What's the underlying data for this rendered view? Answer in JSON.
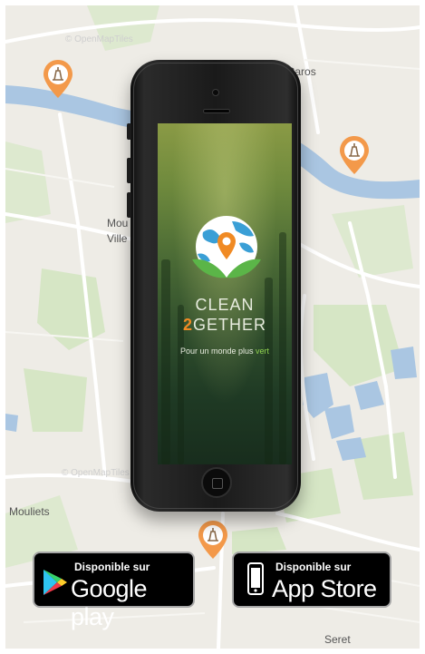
{
  "map": {
    "places": {
      "le_caros": "Le Caros",
      "mou": "Mou",
      "ville": "Ville",
      "mouliets": "Mouliets",
      "seret": "Seret"
    },
    "watermark": "© OpenMapTiles",
    "pin_icon": "litter-location-pin-icon",
    "colors": {
      "land": "#eeece6",
      "water": "#aac6e2",
      "park": "#d6e6c5",
      "road": "#ffffff",
      "pin": "#f3994a"
    }
  },
  "phone": {
    "app": {
      "title_line1": "CLEAN",
      "title_number": "2",
      "title_rest": "GETHER",
      "tagline_main": "Pour un monde plus ",
      "tagline_accent": "vert"
    }
  },
  "badges": {
    "google": {
      "small": "Disponible sur",
      "big": "Google play",
      "icon": "google-play-icon"
    },
    "apple": {
      "small": "Disponible sur",
      "big": "App Store",
      "icon": "phone-icon"
    }
  }
}
